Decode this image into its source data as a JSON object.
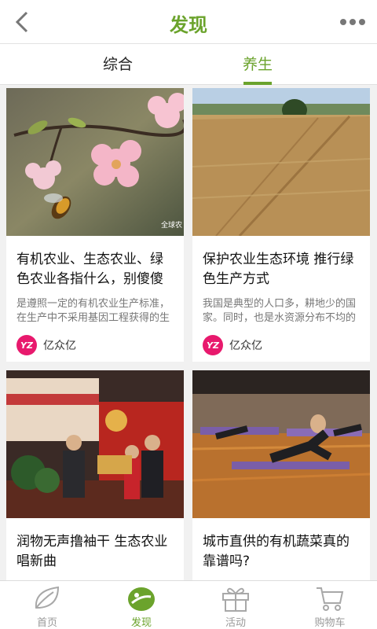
{
  "header": {
    "title": "发现",
    "back_icon": "chevron-left-icon",
    "more_icon": "more-dots-icon"
  },
  "tabs": [
    {
      "label": "综合",
      "active": false
    },
    {
      "label": "养生",
      "active": true
    }
  ],
  "articles": [
    {
      "title": "有机农业、生态农业、绿色农业各指什么，别傻傻",
      "summary": "是遵照一定的有机农业生产标准，在生产中不采用基因工程获得的生",
      "author": "亿众亿",
      "image": "bee-on-blossom-photo",
      "watermark": "全球农"
    },
    {
      "title": "保护农业生态环境 推行绿色生产方式",
      "summary": "我国是典型的人口多，耕地少的国家。同时，也是水资源分布不均的",
      "author": "亿众亿",
      "image": "wheat-field-photo"
    },
    {
      "title": "润物无声撸袖干 生态农业唱新曲",
      "image": "award-ceremony-photo"
    },
    {
      "title": "城市直供的有机蔬菜真的靠谱吗?",
      "image": "yoga-class-photo"
    }
  ],
  "author_logo_text": "YZ",
  "bottom_nav": [
    {
      "label": "首页",
      "icon": "leaf-icon",
      "active": false
    },
    {
      "label": "发现",
      "icon": "discover-bean-icon",
      "active": true
    },
    {
      "label": "活动",
      "icon": "gift-icon",
      "active": false
    },
    {
      "label": "购物车",
      "icon": "cart-icon",
      "active": false
    }
  ],
  "colors": {
    "accent": "#6ba32c",
    "author_logo": "#e8196d",
    "background": "#f1f1f1"
  }
}
